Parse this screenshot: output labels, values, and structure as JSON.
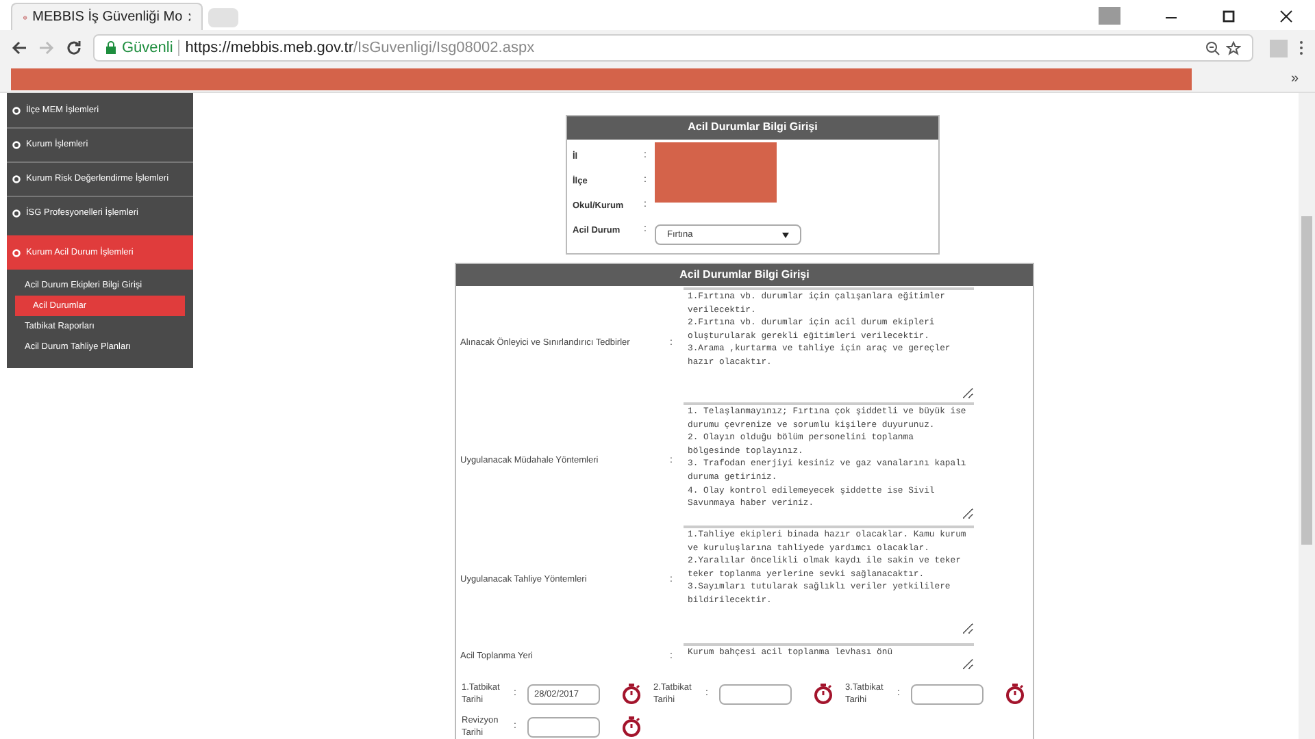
{
  "browser": {
    "tab_title": "MEBBIS İş Güvenliği Mo",
    "security_label": "Güvenli",
    "url_host": "https://mebbis.meb.gov.tr",
    "url_path": "/IsGuvenligi/Isg08002.aspx",
    "bookmarks_overflow": "»"
  },
  "sidebar": {
    "items": [
      {
        "label": "İlçe MEM İşlemleri",
        "selected": false
      },
      {
        "label": "Kurum İşlemleri",
        "selected": false
      },
      {
        "label": "Kurum Risk Değerlendirme İşlemleri",
        "selected": false
      },
      {
        "label": "İSG Profesyonelleri İşlemleri",
        "selected": false
      },
      {
        "label": "Kurum Acil Durum İşlemleri",
        "selected": true,
        "children": [
          {
            "label": "Acil Durum Ekipleri Bilgi Girişi",
            "selected": false
          },
          {
            "label": "Acil Durumlar",
            "selected": true
          },
          {
            "label": "Tatbikat Raporları",
            "selected": false
          },
          {
            "label": "Acil Durum Tahliye Planları",
            "selected": false
          }
        ]
      }
    ]
  },
  "top_form": {
    "title": "Acil Durumlar Bilgi Girişi",
    "separator": ":",
    "fields": [
      {
        "label": "İl",
        "kind": "redacted"
      },
      {
        "label": "İlçe",
        "kind": "redacted"
      },
      {
        "label": "Okul/Kurum",
        "kind": "redacted"
      },
      {
        "label": "Acil Durum",
        "kind": "select",
        "value": "Fırtına"
      }
    ]
  },
  "main_form": {
    "title": "Acil Durumlar Bilgi Girişi",
    "separator": ":",
    "text_fields": [
      {
        "label": "Alınacak Önleyici ve Sınırlandırıcı Tedbirler",
        "value": "1.Fırtına vb. durumlar için çalışanlara eğitimler verilecektir.\n2.Fırtına vb. durumlar için acil durum ekipleri oluşturularak gerekli eğitimleri verilecektir.\n3.Arama ,kurtarma ve tahliye için araç ve gereçler hazır olacaktır."
      },
      {
        "label": "Uygulanacak Müdahale Yöntemleri",
        "value": "1. Telaşlanmayınız; Fırtına çok şiddetli ve büyük ise durumu çevrenize ve sorumlu kişilere duyurunuz.\n2. Olayın olduğu bölüm personelini toplanma bölgesinde toplayınız.\n3. Trafodan enerjiyi kesiniz ve gaz vanalarını kapalı duruma getiriniz.\n4. Olay kontrol edilemeyecek şiddette ise Sivil Savunmaya haber veriniz."
      },
      {
        "label": "Uygulanacak Tahliye Yöntemleri",
        "value": "1.Tahliye ekipleri binada hazır olacaklar. Kamu kurum ve kuruluşlarına tahliyede yardımcı olacaklar.\n2.Yaralılar öncelikli olmak kaydı ile sakin ve teker teker toplanma yerlerine sevki sağlanacaktır.\n3.Sayımları tutularak sağlıklı veriler yetkililere bildirilecektir."
      },
      {
        "label": "Acil Toplanma Yeri",
        "value": "Kurum bahçesi acil toplanma levhası önü"
      }
    ],
    "date_fields": [
      {
        "label": "1.Tatbikat Tarihi",
        "value": "28/02/2017"
      },
      {
        "label": "2.Tatbikat Tarihi"
      },
      {
        "label": "3.Tatbikat Tarihi"
      },
      {
        "label": "Revizyon Tarihi"
      }
    ]
  }
}
